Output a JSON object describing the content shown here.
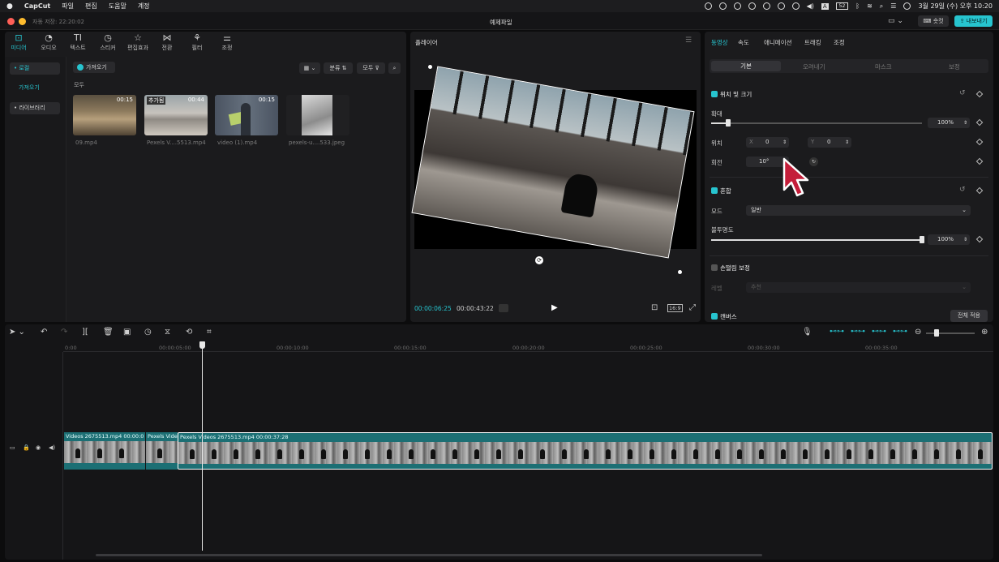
{
  "menubar": {
    "app": "CapCut",
    "menus": [
      "파일",
      "편집",
      "도움말",
      "계정"
    ],
    "clock": "3월 29일 (수) 오후 10:20"
  },
  "titlebar": {
    "autosave": "자동 저장: 22:20:02",
    "project": "예제파일",
    "shortcut_label": "숏컷",
    "export_label": "내보내기"
  },
  "media_tabs": [
    {
      "label": "미디어",
      "icon": "media-icon",
      "active": true
    },
    {
      "label": "오디오",
      "icon": "audio-icon"
    },
    {
      "label": "텍스트",
      "icon": "text-icon"
    },
    {
      "label": "스티커",
      "icon": "sticker-icon"
    },
    {
      "label": "편집효과",
      "icon": "effects-icon"
    },
    {
      "label": "전환",
      "icon": "transition-icon"
    },
    {
      "label": "필터",
      "icon": "filter-icon"
    },
    {
      "label": "조정",
      "icon": "adjust-icon"
    }
  ],
  "sidebar": {
    "local": "• 로컬",
    "import": "가져오기",
    "library": "• 라이브러리"
  },
  "media": {
    "import_button": "가져오기",
    "sort_label": "분류",
    "filter_label": "모두",
    "section_all": "모두",
    "items": [
      {
        "name": "09.mp4",
        "duration": "00:15",
        "badge": ""
      },
      {
        "name": "Pexels V....5513.mp4",
        "duration": "00:44",
        "badge": "추가됨"
      },
      {
        "name": "video (1).mp4",
        "duration": "00:15",
        "badge": ""
      },
      {
        "name": "pexels-u....533.jpeg",
        "duration": "",
        "badge": ""
      }
    ]
  },
  "player": {
    "title": "플레이어",
    "current_time": "00:00:06:25",
    "total_time": "00:00:43:22",
    "ratio": "16:9"
  },
  "inspector": {
    "tabs": [
      "동영상",
      "속도",
      "애니메이션",
      "트래킹",
      "조정"
    ],
    "subtabs": [
      "기본",
      "오려내기",
      "마스크",
      "보정"
    ],
    "position_size": "위치 및 크기",
    "scale_label": "확대",
    "scale_value": "100%",
    "scale_fraction": 0.08,
    "position_label": "위치",
    "x_label": "X",
    "x_value": "0",
    "y_label": "Y",
    "y_value": "0",
    "rotate_label": "회전",
    "rotate_value": "10°",
    "blend_label": "혼합",
    "mode_label": "모드",
    "mode_value": "일반",
    "opacity_label": "불투명도",
    "opacity_value": "100%",
    "opacity_fraction": 1.0,
    "stabilize_label": "손떨림 보정",
    "stabilize_sub_label": "레벨",
    "stabilize_value": "추천",
    "canvas_label": "캔버스",
    "apply_all": "전체 적용"
  },
  "timeline": {
    "ticks": [
      "0:00",
      "00:00:05:00",
      "00:00:10:00",
      "00:00:15:00",
      "00:00:20:00",
      "00:00:25:00",
      "00:00:30:00",
      "00:00:35:00"
    ],
    "clips": [
      {
        "label": "Videos 2675513.mp4  00:00:0"
      },
      {
        "label": "Pexels Vide"
      },
      {
        "label": "Pexels Videos 2675513.mp4   00:00:37:28"
      }
    ]
  },
  "colors": {
    "accent": "#27c4cf",
    "clip": "#1c6f74"
  }
}
